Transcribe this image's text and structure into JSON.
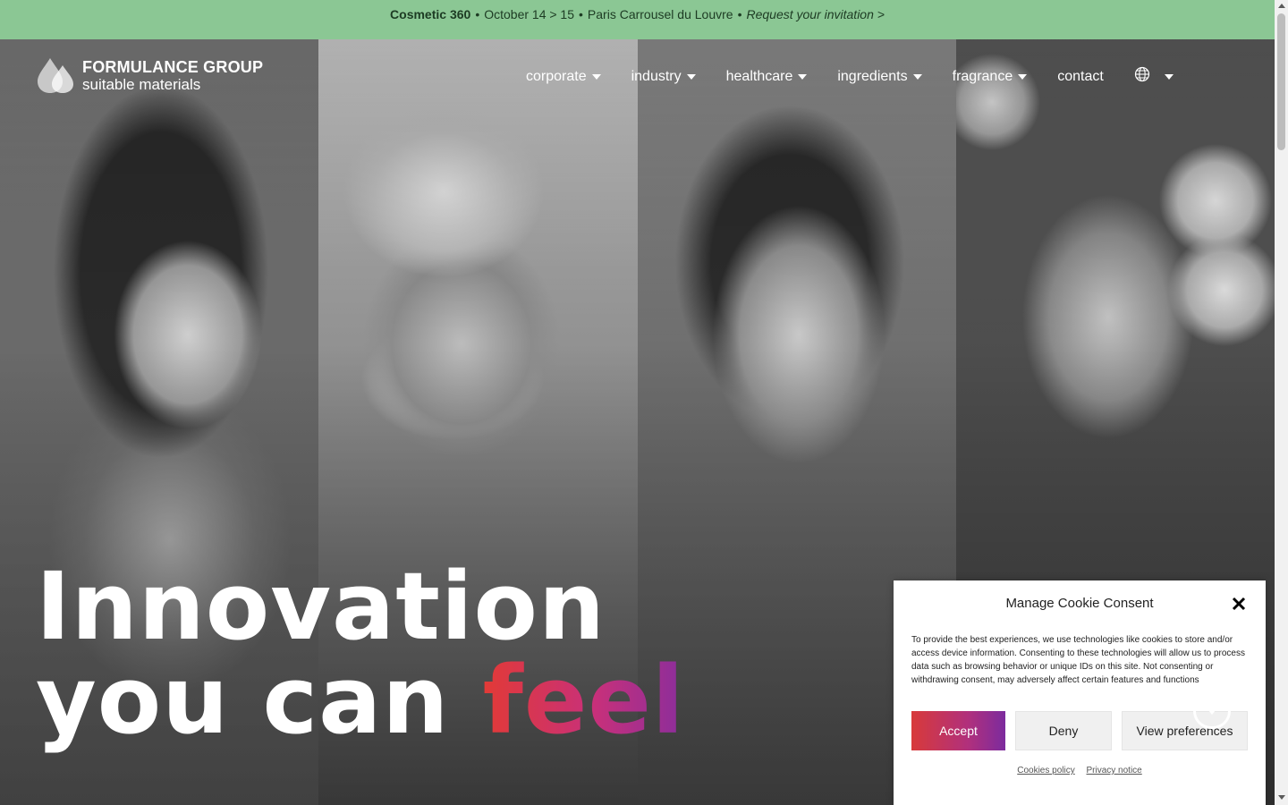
{
  "announcement": {
    "event": "Cosmetic 360",
    "sep1": "•",
    "dates": "October 14 > 15",
    "sep2": "•",
    "location": "Paris Carrousel du Louvre",
    "sep3": "•",
    "cta": "Request your invitation >"
  },
  "logo": {
    "title": "FORMULANCE GROUP",
    "subtitle": "suitable materials"
  },
  "nav": {
    "items": [
      {
        "label": "corporate"
      },
      {
        "label": "industry"
      },
      {
        "label": "healthcare"
      },
      {
        "label": "ingredients"
      },
      {
        "label": "fragrance"
      }
    ],
    "contact": "contact",
    "language_icon": "globe-icon"
  },
  "hero": {
    "line1": "Innovation",
    "line2_prefix": "you can",
    "line2_highlight": "feel"
  },
  "cookie": {
    "title": "Manage Cookie Consent",
    "text": "To provide the best experiences, we use technologies like cookies to store and/or access device information. Consenting to these technologies will allow us to process data such as browsing behavior or unique IDs on this site. Not consenting or withdrawing consent, may adversely affect certain features and functions.",
    "accept": "Accept",
    "deny": "Deny",
    "preferences": "View preferences",
    "links": [
      "Cookies policy",
      "Privacy notice"
    ]
  },
  "colors": {
    "announcement_bg": "#8bc794",
    "accent_gradient_start": "#e23a36",
    "accent_gradient_end": "#8a2e9c"
  }
}
